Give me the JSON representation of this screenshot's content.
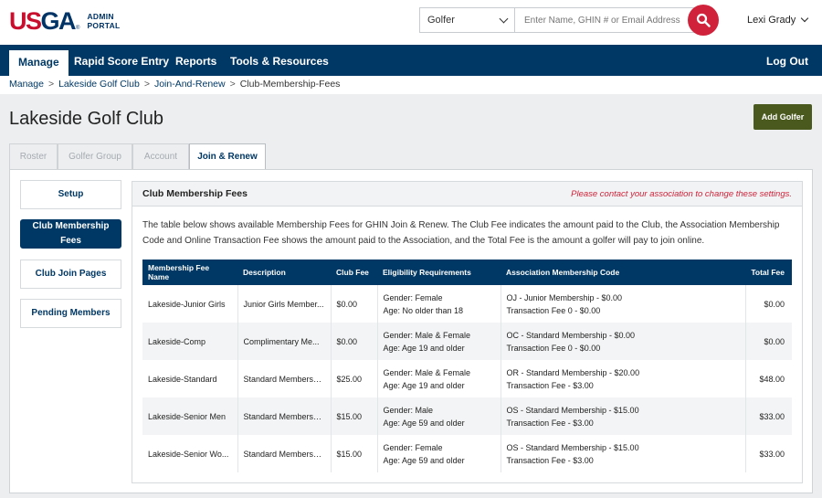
{
  "header": {
    "logo_text": "USGA",
    "logo_sub_1": "ADMIN",
    "logo_sub_2": "PORTAL",
    "search_type": "Golfer",
    "search_placeholder": "Enter Name, GHIN # or Email Address",
    "user_name": "Lexi Grady"
  },
  "nav": {
    "items": [
      "Manage",
      "Rapid Score Entry",
      "Reports",
      "Tools & Resources"
    ],
    "logout": "Log Out"
  },
  "breadcrumb": [
    "Manage",
    "Lakeside Golf Club",
    "Join-And-Renew",
    "Club-Membership-Fees"
  ],
  "page": {
    "title": "Lakeside Golf Club",
    "add_button": "Add Golfer"
  },
  "tabs": [
    "Roster",
    "Golfer Group",
    "Account",
    "Join & Renew"
  ],
  "side_menu": [
    "Setup",
    "Club Membership Fees",
    "Club Join Pages",
    "Pending Members"
  ],
  "content": {
    "title": "Club Membership Fees",
    "warning": "Please contact your association to change these settings.",
    "description": "The table below shows available Membership Fees for GHIN Join & Renew. The Club Fee indicates the amount paid to the Club, the Association Membership Code and Online Transaction Fee shows the amount paid to the Association, and the Total Fee is the amount a golfer will pay to join online."
  },
  "table": {
    "headers": [
      "Membership Fee Name",
      "Description",
      "Club Fee",
      "Eligibility Requirements",
      "Association Membership Code",
      "Total Fee"
    ],
    "rows": [
      {
        "name": "Lakeside-Junior Girls",
        "desc": "Junior Girls Member...",
        "club_fee": "$0.00",
        "elig1": "Gender: Female",
        "elig2": "Age: No older than 18",
        "code1": "OJ - Junior Membership - $0.00",
        "code2": "Transaction Fee 0 - $0.00",
        "total": "$0.00"
      },
      {
        "name": "Lakeside-Comp",
        "desc": "Complimentary Me...",
        "club_fee": "$0.00",
        "elig1": "Gender: Male & Female",
        "elig2": "Age: Age 19 and older",
        "code1": "OC - Standard Membership - $0.00",
        "code2": "Transaction Fee 0 - $0.00",
        "total": "$0.00"
      },
      {
        "name": "Lakeside-Standard",
        "desc": "Standard Membersh...",
        "club_fee": "$25.00",
        "elig1": "Gender: Male & Female",
        "elig2": "Age: Age 19 and older",
        "code1": "OR - Standard Membership - $20.00",
        "code2": "Transaction Fee - $3.00",
        "total": "$48.00"
      },
      {
        "name": "Lakeside-Senior Men",
        "desc": "Standard Membersh...",
        "club_fee": "$15.00",
        "elig1": "Gender: Male",
        "elig2": "Age: Age 59 and older",
        "code1": "OS - Standard Membership - $15.00",
        "code2": "Transaction Fee - $3.00",
        "total": "$33.00"
      },
      {
        "name": "Lakeside-Senior Wo...",
        "desc": "Standard Membersh...",
        "club_fee": "$15.00",
        "elig1": "Gender: Female",
        "elig2": "Age: Age 59 and older",
        "code1": "OS - Standard Membership - $15.00",
        "code2": "Transaction Fee - $3.00",
        "total": "$33.00"
      }
    ]
  },
  "colors": {
    "brand_red": "#c8102e",
    "navy": "#003865",
    "add_button": "#4a5a1f"
  }
}
